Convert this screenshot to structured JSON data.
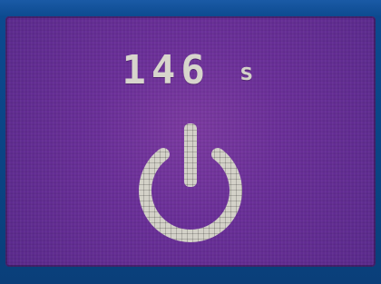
{
  "display": {
    "timer_value": "146",
    "timer_unit": "s",
    "icon": "power-icon"
  },
  "colors": {
    "background_purple": "#6a2f98",
    "frame_blue": "#0a3f7a",
    "foreground_gray": "#d3d1c8"
  }
}
